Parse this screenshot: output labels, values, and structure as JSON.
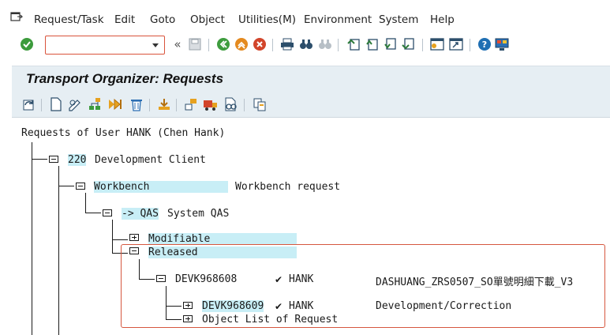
{
  "menu": {
    "items": [
      "Request/Task",
      "Edit",
      "Goto",
      "Object",
      "Utilities(M)",
      "Environment",
      "System",
      "Help"
    ]
  },
  "toolbar": {
    "command_value": "",
    "icons": [
      "enter-icon",
      "back-arrows-icon",
      "save-icon",
      "back-icon",
      "exit-icon",
      "cancel-icon",
      "print-icon",
      "find-icon",
      "find-next-icon",
      "first-page-icon",
      "previous-page-icon",
      "next-page-icon",
      "last-page-icon",
      "create-session-icon",
      "shortcut-icon",
      "help-icon",
      "customize-layout-icon"
    ]
  },
  "page": {
    "title": "Transport Organizer: Requests"
  },
  "app_toolbar": {
    "icons": [
      "refresh-icon",
      "create-icon",
      "change-display-icon",
      "hierarchy-icon",
      "check-icon",
      "delete-icon",
      "add-user-icon",
      "transport-icon",
      "release-truck-icon",
      "glasses-icon",
      "copy-icon"
    ]
  },
  "tree": {
    "header": "Requests of User HANK (Chen Hank)",
    "client": {
      "code": "220",
      "label": "Development Client"
    },
    "workbench": {
      "label": "Workbench",
      "description": "Workbench request"
    },
    "target": {
      "label": "-> QAS",
      "description": "System QAS"
    },
    "modifiable": "Modifiable",
    "released": "Released",
    "request1": {
      "id": "DEVK968608",
      "check": "✔",
      "owner": "HANK",
      "description": "DASHUANG_ZRS0507_SO單號明細下載_V3"
    },
    "request2": {
      "id": "DEVK968609",
      "check": "✔",
      "owner": "HANK",
      "description": "Development/Correction"
    },
    "object_list": "Object List of Request"
  }
}
